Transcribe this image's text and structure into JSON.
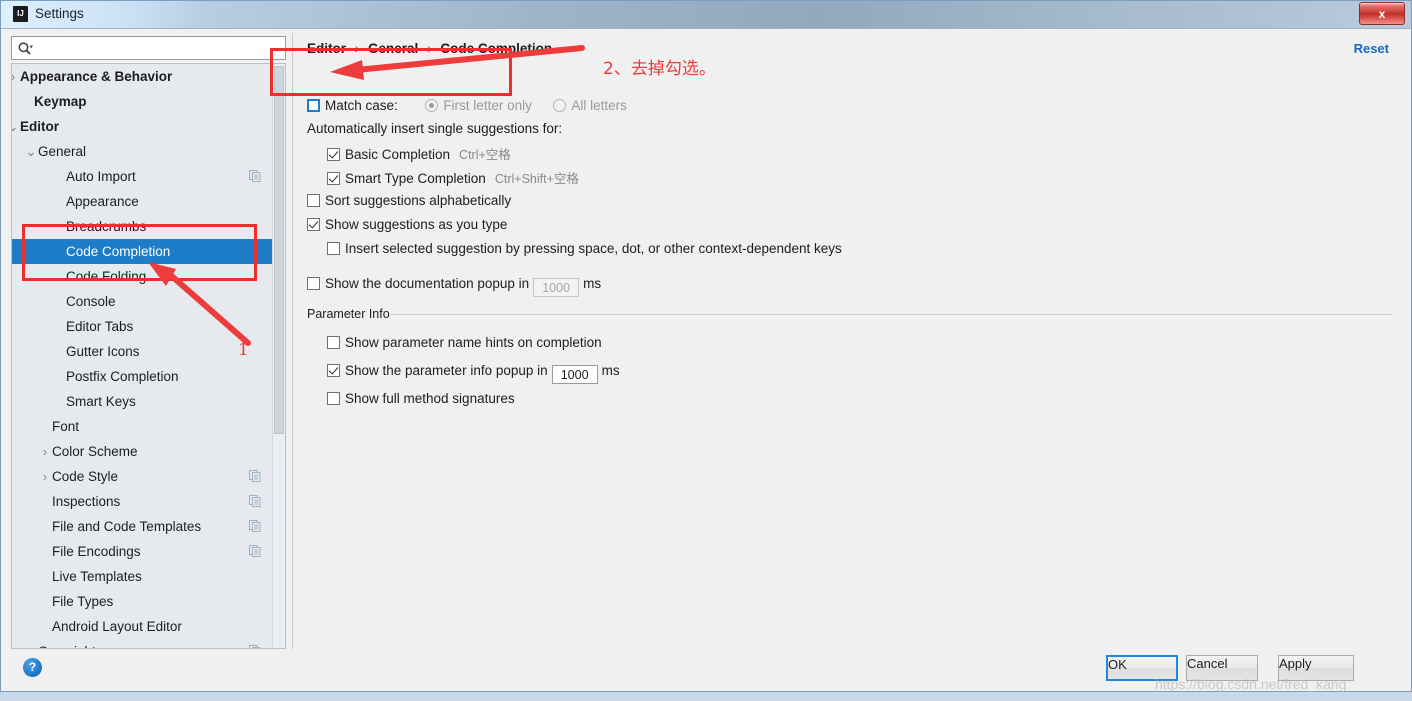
{
  "window": {
    "title": "Settings",
    "app_icon": "intellij-icon",
    "close_label": "x"
  },
  "search": {
    "placeholder": "",
    "value": "",
    "icon": "search-icon"
  },
  "sidebar": {
    "items": [
      {
        "label": "Appearance & Behavior",
        "indent": 8,
        "twisty": "collapsed",
        "bold": true,
        "selected": false,
        "module_icon": false
      },
      {
        "label": "Keymap",
        "indent": 22,
        "twisty": "none",
        "bold": true,
        "selected": false,
        "module_icon": false
      },
      {
        "label": "Editor",
        "indent": 8,
        "twisty": "expanded",
        "bold": true,
        "selected": false,
        "module_icon": false
      },
      {
        "label": "General",
        "indent": 26,
        "twisty": "expanded",
        "bold": false,
        "selected": false,
        "module_icon": false
      },
      {
        "label": "Auto Import",
        "indent": 54,
        "twisty": "none",
        "bold": false,
        "selected": false,
        "module_icon": true
      },
      {
        "label": "Appearance",
        "indent": 54,
        "twisty": "none",
        "bold": false,
        "selected": false,
        "module_icon": false
      },
      {
        "label": "Breadcrumbs",
        "indent": 54,
        "twisty": "none",
        "bold": false,
        "selected": false,
        "module_icon": false
      },
      {
        "label": "Code Completion",
        "indent": 54,
        "twisty": "none",
        "bold": false,
        "selected": true,
        "module_icon": false
      },
      {
        "label": "Code Folding",
        "indent": 54,
        "twisty": "none",
        "bold": false,
        "selected": false,
        "module_icon": false
      },
      {
        "label": "Console",
        "indent": 54,
        "twisty": "none",
        "bold": false,
        "selected": false,
        "module_icon": false
      },
      {
        "label": "Editor Tabs",
        "indent": 54,
        "twisty": "none",
        "bold": false,
        "selected": false,
        "module_icon": false
      },
      {
        "label": "Gutter Icons",
        "indent": 54,
        "twisty": "none",
        "bold": false,
        "selected": false,
        "module_icon": false
      },
      {
        "label": "Postfix Completion",
        "indent": 54,
        "twisty": "none",
        "bold": false,
        "selected": false,
        "module_icon": false
      },
      {
        "label": "Smart Keys",
        "indent": 54,
        "twisty": "none",
        "bold": false,
        "selected": false,
        "module_icon": false
      },
      {
        "label": "Font",
        "indent": 40,
        "twisty": "none",
        "bold": false,
        "selected": false,
        "module_icon": false
      },
      {
        "label": "Color Scheme",
        "indent": 40,
        "twisty": "collapsed",
        "bold": false,
        "selected": false,
        "module_icon": false
      },
      {
        "label": "Code Style",
        "indent": 40,
        "twisty": "collapsed",
        "bold": false,
        "selected": false,
        "module_icon": true
      },
      {
        "label": "Inspections",
        "indent": 40,
        "twisty": "none",
        "bold": false,
        "selected": false,
        "module_icon": true
      },
      {
        "label": "File and Code Templates",
        "indent": 40,
        "twisty": "none",
        "bold": false,
        "selected": false,
        "module_icon": true
      },
      {
        "label": "File Encodings",
        "indent": 40,
        "twisty": "none",
        "bold": false,
        "selected": false,
        "module_icon": true
      },
      {
        "label": "Live Templates",
        "indent": 40,
        "twisty": "none",
        "bold": false,
        "selected": false,
        "module_icon": false
      },
      {
        "label": "File Types",
        "indent": 40,
        "twisty": "none",
        "bold": false,
        "selected": false,
        "module_icon": false
      },
      {
        "label": "Android Layout Editor",
        "indent": 40,
        "twisty": "none",
        "bold": false,
        "selected": false,
        "module_icon": false
      },
      {
        "label": "Copyright",
        "indent": 26,
        "twisty": "collapsed",
        "bold": false,
        "selected": false,
        "module_icon": true
      }
    ]
  },
  "main": {
    "breadcrumb": {
      "part1": "Editor",
      "sep": "›",
      "part2": "General",
      "part3": "Code Completion"
    },
    "reset_label": "Reset",
    "match_case": {
      "label": "Match case:",
      "checked": false,
      "option_first_letter": "First letter only",
      "option_all_letters": "All letters",
      "selected_option": "First letter only",
      "disabled": true
    },
    "auto_insert_label": "Automatically insert single suggestions for:",
    "auto_insert_items": [
      {
        "label": "Basic Completion",
        "shortcut": "Ctrl+空格",
        "checked": true
      },
      {
        "label": "Smart Type Completion",
        "shortcut": "Ctrl+Shift+空格",
        "checked": true
      }
    ],
    "sort_suggestions": {
      "label": "Sort suggestions alphabetically",
      "checked": false
    },
    "show_as_you_type": {
      "label": "Show suggestions as you type",
      "checked": true
    },
    "insert_selected": {
      "label": "Insert selected suggestion by pressing space, dot, or other context-dependent keys",
      "checked": false
    },
    "doc_popup": {
      "label": "Show the documentation popup in",
      "checked": false,
      "value": "1000",
      "unit": "ms",
      "disabled": true
    },
    "parameter_info": {
      "group_title": "Parameter Info",
      "name_hints": {
        "label": "Show parameter name hints on completion",
        "checked": false
      },
      "popup": {
        "label": "Show the parameter info popup in",
        "checked": true,
        "value": "1000",
        "unit": "ms",
        "disabled": false
      },
      "full_signatures": {
        "label": "Show full method signatures",
        "checked": false
      }
    }
  },
  "footer": {
    "help_label": "?",
    "ok_label": "OK",
    "cancel_label": "Cancel",
    "apply_label": "Apply"
  },
  "annotations": {
    "step1_number": "1",
    "step2_text": "2、去掉勾选。",
    "accent_red": "#ee2d2d"
  },
  "watermark": {
    "text": "https://blog.csdn.net/fred_kang"
  }
}
